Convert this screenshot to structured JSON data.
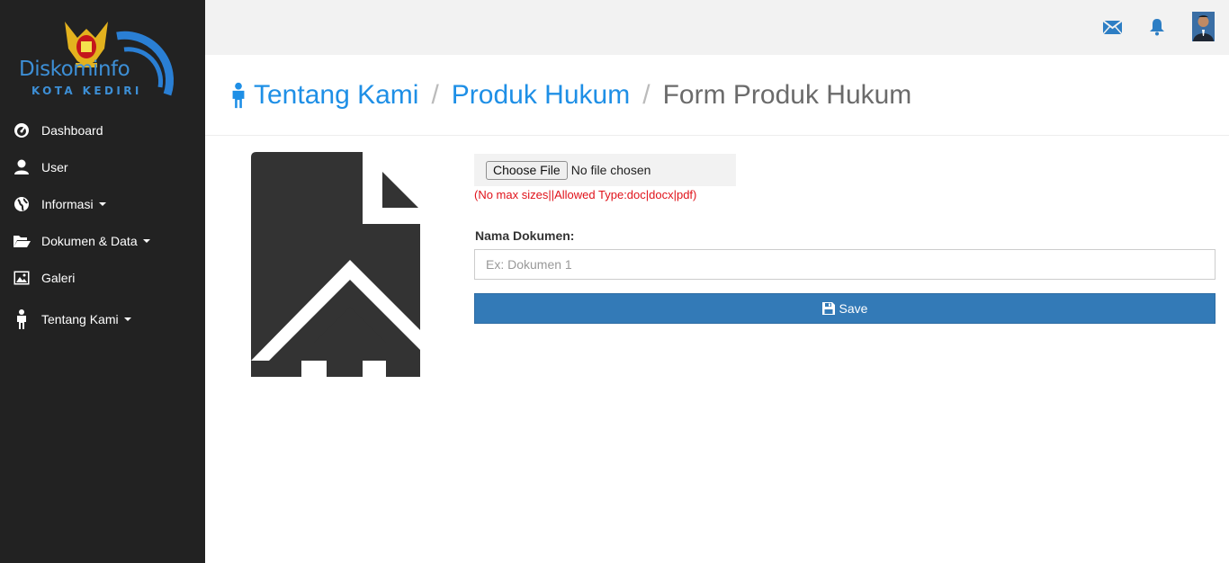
{
  "brand": {
    "name": "Diskominfo",
    "subtitle": "KOTA KEDIRI",
    "accent_color": "#3d8fd6"
  },
  "sidebar": {
    "items": [
      {
        "label": "Dashboard",
        "icon": "dashboard-icon"
      },
      {
        "label": "User",
        "icon": "user-icon"
      },
      {
        "label": "Informasi",
        "icon": "globe-icon",
        "dropdown": true
      },
      {
        "label": "Dokumen & Data",
        "icon": "folder-open-icon",
        "dropdown": true
      },
      {
        "label": "Galeri",
        "icon": "picture-icon"
      },
      {
        "label": "Tentang Kami",
        "icon": "person-icon",
        "dropdown": true
      }
    ]
  },
  "topbar": {
    "icons": [
      "envelope-icon",
      "bell-icon",
      "avatar"
    ]
  },
  "breadcrumb": {
    "icon": "person-icon",
    "items": [
      "Tentang Kami",
      "Produk Hukum",
      "Form Produk Hukum"
    ],
    "separator": "/"
  },
  "form": {
    "file_button": "Choose File",
    "file_status": "No file chosen",
    "file_hint": "(No max sizes||Allowed Type:doc|docx|pdf)",
    "name_label": "Nama Dokumen:",
    "name_value": "",
    "name_placeholder": "Ex: Dokumen 1",
    "save_label": "Save",
    "upload_graphic": "file-upload-icon"
  },
  "colors": {
    "sidebar_bg": "#222222",
    "link": "#1e8fe6",
    "primary_button": "#337ab7",
    "hint": "#e0121a"
  }
}
